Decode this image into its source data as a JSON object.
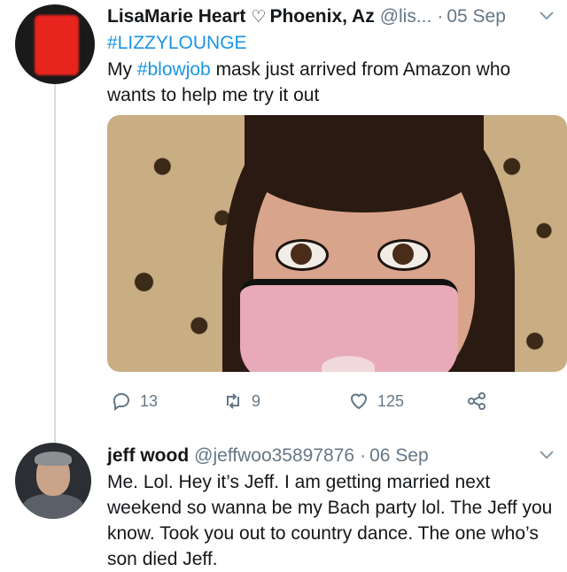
{
  "tweet1": {
    "name": "LisaMarie Heart",
    "heart_icon": "heart-outline-icon",
    "location": "Phoenix, Az",
    "handle": "@lis...",
    "dot": "·",
    "date": "05 Sep",
    "chevron_icon": "chevron-down-icon",
    "hashtag_line": "#LIZZYLOUNGE",
    "text_before": "My ",
    "text_hashtag": "#blowjob",
    "text_after": " mask just arrived from Amazon who wants to help me try it out",
    "actions": {
      "reply_count": "13",
      "retweet_count": "9",
      "like_count": "125"
    }
  },
  "tweet2": {
    "name": "jeff wood",
    "handle": "@jeffwoo35897876",
    "dot": "·",
    "date": "06 Sep",
    "chevron_icon": "chevron-down-icon",
    "text": "Me. Lol. Hey it’s Jeff. I am getting married next weekend so wanna be my Bach party lol. The Jeff you know. Took you out to country dance. The one who’s son died Jeff."
  },
  "colors": {
    "link": "#1b95e0",
    "secondary_text": "#657786",
    "thread_line": "#d6dbe0"
  }
}
